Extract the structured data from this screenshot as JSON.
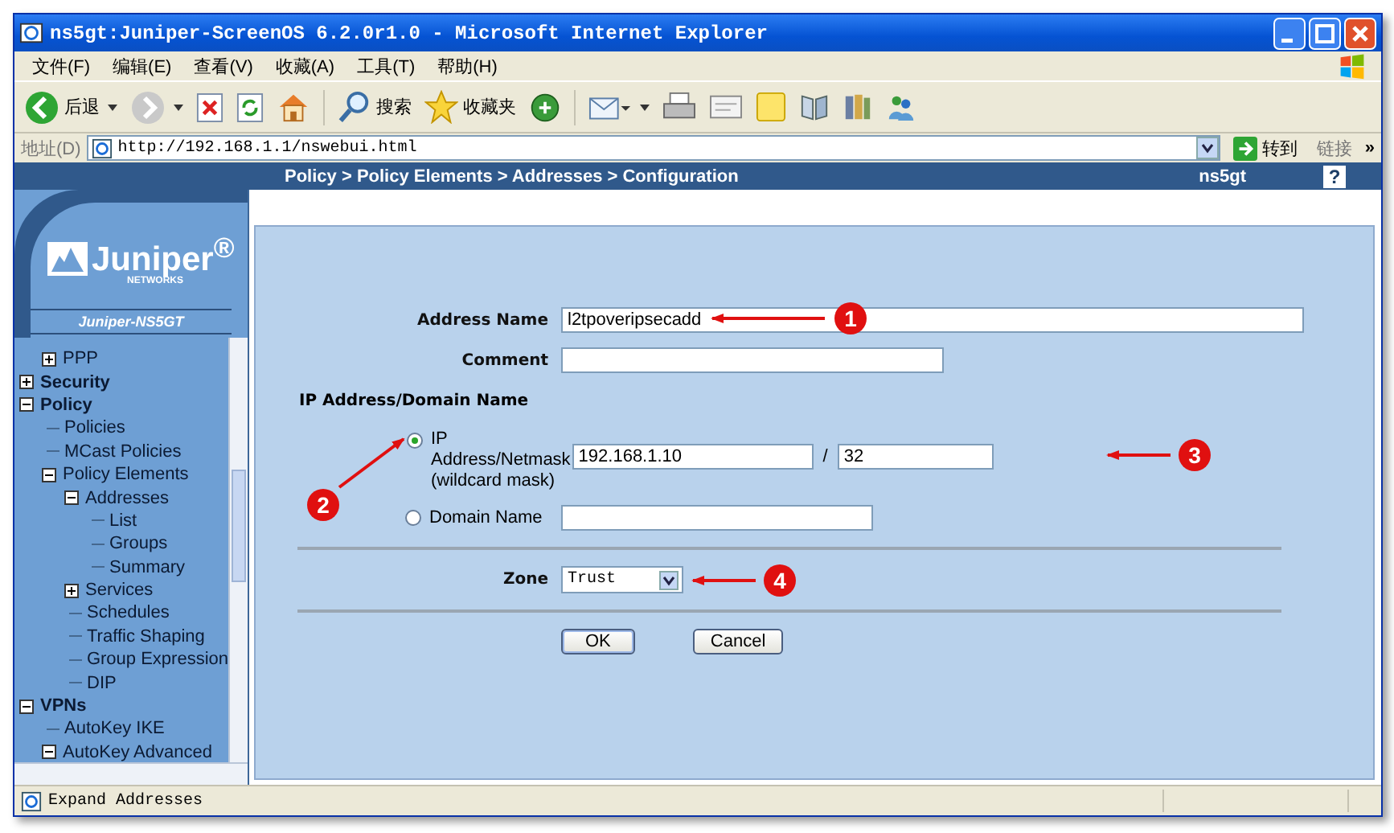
{
  "window": {
    "title": "ns5gt:Juniper-ScreenOS 6.2.0r1.0 - Microsoft Internet Explorer"
  },
  "menu": [
    "文件(F)",
    "编辑(E)",
    "查看(V)",
    "收藏(A)",
    "工具(T)",
    "帮助(H)"
  ],
  "toolbar": [
    {
      "kind": "back",
      "label": "后退"
    },
    {
      "kind": "forward"
    },
    {
      "kind": "stop"
    },
    {
      "kind": "refresh"
    },
    {
      "kind": "home"
    },
    {
      "kind": "search",
      "label": "搜索"
    },
    {
      "kind": "favorites",
      "label": "收藏夹"
    },
    {
      "kind": "media"
    },
    {
      "kind": "mail"
    },
    {
      "kind": "print"
    },
    {
      "kind": "edit"
    },
    {
      "kind": "note"
    },
    {
      "kind": "research"
    },
    {
      "kind": "tools"
    },
    {
      "kind": "messenger"
    }
  ],
  "address_bar": {
    "label": "地址(D)",
    "value": "http://192.168.1.1/nswebui.html",
    "go_button": "转到",
    "links": "链接",
    "more": "»"
  },
  "header": {
    "breadcrumb": "Policy > Policy Elements > Addresses > Configuration",
    "device": "ns5gt",
    "help": "?"
  },
  "sidebar": {
    "logo": "Juniper$^{®}$",
    "logo_sub": "NETWORKS",
    "device_label": "Juniper-NS5GT",
    "tree": [
      {
        "children": [
          {
            "label": "PPP",
            "expanded": false
          }
        ]
      },
      {
        "label": "Security",
        "expanded": false
      },
      {
        "label": "Policy",
        "expanded": true,
        "children": [
          {
            "label": "Policies"
          },
          {
            "label": "MCast Policies"
          },
          {
            "label": "Policy Elements",
            "expanded": true,
            "children": [
              {
                "label": "Addresses",
                "expanded": true,
                "children": [
                  {
                    "label": "List"
                  },
                  {
                    "label": "Groups"
                  },
                  {
                    "label": "Summary"
                  }
                ]
              },
              {
                "label": "Services",
                "expanded": false
              },
              {
                "label": "Schedules"
              },
              {
                "label": "Traffic Shaping"
              },
              {
                "label": "Group Expression"
              },
              {
                "label": "DIP"
              }
            ]
          }
        ]
      },
      {
        "label": "VPNs",
        "expanded": true,
        "children": [
          {
            "label": "AutoKey IKE"
          },
          {
            "label": "AutoKey Advanced",
            "expanded": true
          }
        ]
      }
    ]
  },
  "form": {
    "address_name": {
      "label": "Address Name",
      "value": "l2tpoveripsecadd"
    },
    "comment": {
      "label": "Comment"
    },
    "section_title": "IP Address/Domain Name",
    "options": [
      {
        "kind": "ip",
        "label": "IP Address/Netmask (wildcard mask)",
        "selected": true,
        "ip": "192.168.1.10",
        "separator": "/",
        "mask": "32"
      },
      {
        "kind": "domain",
        "label": "Domain Name",
        "selected": false
      }
    ],
    "zone": {
      "label": "Zone",
      "value": "Trust"
    },
    "buttons": [
      "OK",
      "Cancel"
    ]
  },
  "annotations": [
    "1",
    "2",
    "3",
    "4"
  ],
  "status_bar": {
    "text": "Expand Addresses"
  }
}
